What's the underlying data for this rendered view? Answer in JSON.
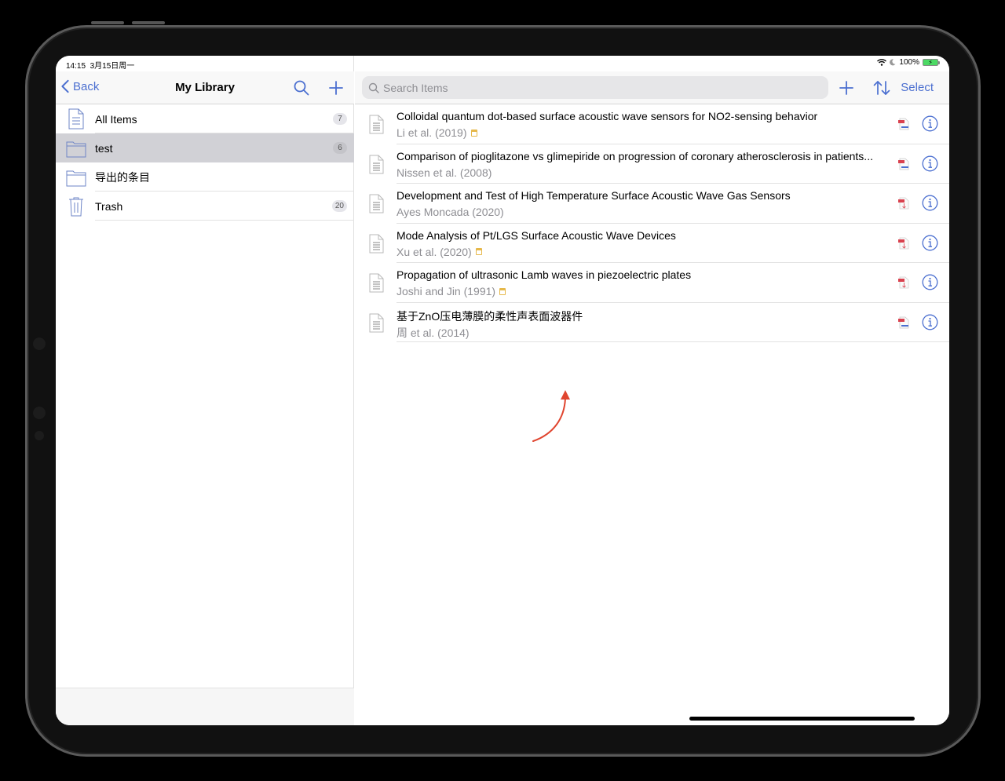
{
  "status_bar": {
    "time": "14:15",
    "date": "3月15日周一",
    "battery": "100%",
    "wifi_icon": "wifi-icon",
    "moon_icon": "moon-icon",
    "battery_icon": "battery-charging-icon"
  },
  "left_nav": {
    "back_label": "Back",
    "title": "My Library",
    "search_icon": "search-icon",
    "add_icon": "plus-icon"
  },
  "library": [
    {
      "label": "All Items",
      "count": "7",
      "icon": "document-icon",
      "selected": false
    },
    {
      "label": "test",
      "count": "6",
      "icon": "folder-icon",
      "selected": true
    },
    {
      "label": "导出的条目",
      "count": "",
      "icon": "folder-icon",
      "selected": false
    },
    {
      "label": "Trash",
      "count": "20",
      "icon": "trash-icon",
      "selected": false
    }
  ],
  "right_nav": {
    "search_placeholder": "Search Items",
    "search_value": "",
    "add_icon": "plus-icon",
    "sort_icon": "sort-icon",
    "select_label": "Select"
  },
  "items": [
    {
      "title": "Colloidal quantum dot-based surface acoustic wave sensors for NO2-sensing behavior",
      "creator": "Li et al. (2019)",
      "has_note": true,
      "pdf": "downloaded"
    },
    {
      "title": "Comparison of pioglitazone vs glimepiride on progression of coronary atherosclerosis in patients...",
      "creator": "Nissen et al. (2008)",
      "has_note": false,
      "pdf": "downloaded"
    },
    {
      "title": "Development and Test of High Temperature Surface Acoustic Wave Gas Sensors",
      "creator": "Ayes Moncada (2020)",
      "has_note": false,
      "pdf": "not-downloaded"
    },
    {
      "title": "Mode Analysis of Pt/LGS Surface Acoustic Wave Devices",
      "creator": "Xu et al. (2020)",
      "has_note": true,
      "pdf": "not-downloaded"
    },
    {
      "title": "Propagation of ultrasonic Lamb waves in piezoelectric plates",
      "creator": "Joshi and Jin (1991)",
      "has_note": true,
      "pdf": "not-downloaded"
    },
    {
      "title": "基于ZnO压电薄膜的柔性声表面波器件",
      "creator": "周 et al. (2014)",
      "has_note": false,
      "pdf": "downloaded"
    }
  ],
  "colors": {
    "accent": "#4b6fd0",
    "selected_row": "#d1d1d6",
    "annotation": "#e0452f",
    "pdf_red": "#d9414e",
    "note_yellow": "#e6b84a"
  }
}
